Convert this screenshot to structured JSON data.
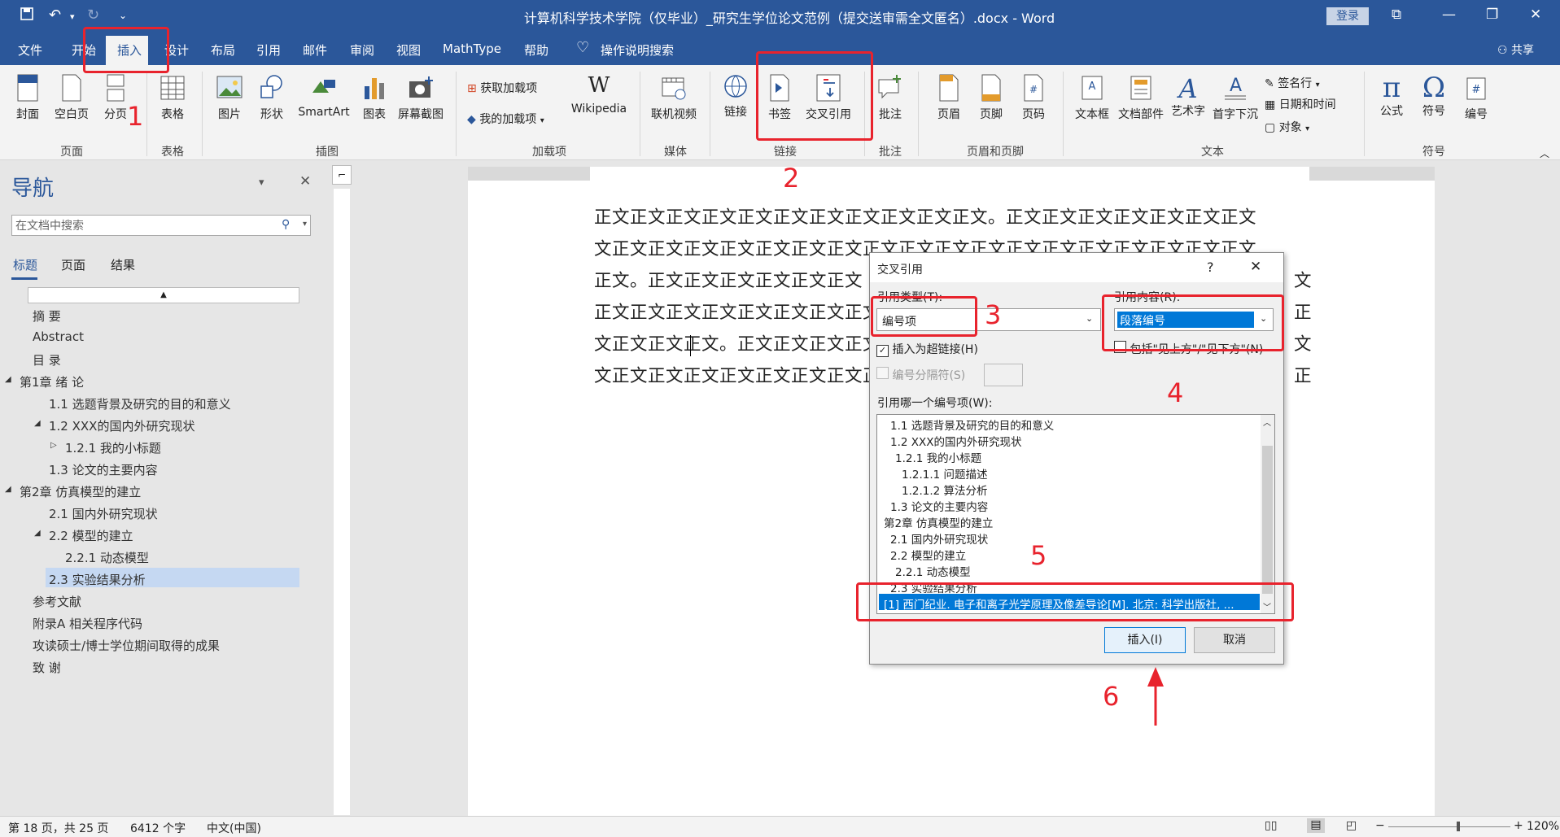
{
  "window": {
    "title": "计算机科学技术学院（仅毕业）_研究生学位论文范例（提交送审需全文匿名）.docx - Word",
    "login": "登录",
    "share": "共享"
  },
  "tabs": [
    "文件",
    "开始",
    "插入",
    "设计",
    "布局",
    "引用",
    "邮件",
    "审阅",
    "视图",
    "MathType",
    "帮助",
    "操作说明搜索"
  ],
  "ribbon": {
    "buttons": [
      "封面",
      "空白页",
      "分页",
      "表格",
      "图片",
      "形状",
      "SmartArt",
      "图表",
      "屏幕截图",
      "获取加载项",
      "我的加载项",
      "Wikipedia",
      "联机视频",
      "链接",
      "书签",
      "交叉引用",
      "批注",
      "页眉",
      "页脚",
      "页码",
      "文本框",
      "文档部件",
      "艺术字",
      "首字下沉",
      "签名行",
      "日期和时间",
      "对象",
      "公式",
      "符号",
      "编号"
    ],
    "groups": [
      "页面",
      "表格",
      "插图",
      "加载项",
      "媒体",
      "链接",
      "批注",
      "页眉和页脚",
      "文本",
      "符号"
    ]
  },
  "nav": {
    "title": "导航",
    "search_placeholder": "在文档中搜索",
    "tabs": [
      "标题",
      "页面",
      "结果"
    ],
    "items": [
      "摘 要",
      "Abstract",
      "目 录",
      "第1章 绪 论",
      "1.1 选题背景及研究的目的和意义",
      "1.2 XXX的国内外研究现状",
      "1.2.1 我的小标题",
      "1.3 论文的主要内容",
      "第2章 仿真模型的建立",
      "2.1 国内外研究现状",
      "2.2 模型的建立",
      "2.2.1 动态模型",
      "2.3 实验结果分析",
      "参考文献",
      "附录A 相关程序代码",
      "攻读硕士/博士学位期间取得的成果",
      "致 谢"
    ]
  },
  "document": {
    "lines": [
      "正文正文正文正文正文正文正文正文正文正文正文。正文正文正文正文正文正文正文",
      "文正文正文正文正文正文正文正文正文正文正文正文正文正文正文正文正文正文正文",
      "正文。正文正文正文正文正文正文",
      "正文正文正文正文正文正文正文正文",
      "文正文正文正文。正文正文正文正文正文",
      "文正文正文正文正文正文正文正文正文"
    ],
    "right_fragments": [
      "文",
      "正",
      "文",
      "正"
    ]
  },
  "dialog": {
    "title": "交叉引用",
    "help": "?",
    "ref_type_label": "引用类型(T):",
    "ref_type_value": "编号项",
    "ref_content_label": "引用内容(R):",
    "ref_content_value": "段落编号",
    "insert_hyperlink": "插入为超链接(H)",
    "include_above_below": "包括\"见上方\"/\"见下方\"(N)",
    "separator_label": "编号分隔符(S)",
    "which_label": "引用哪一个编号项(W):",
    "list": [
      "1.1 选题背景及研究的目的和意义",
      "1.2 XXX的国内外研究现状",
      "1.2.1 我的小标题",
      "1.2.1.1 问题描述",
      "1.2.1.2 算法分析",
      "1.3 论文的主要内容",
      "第2章 仿真模型的建立",
      "2.1 国内外研究现状",
      "2.2 模型的建立",
      "2.2.1 动态模型",
      "2.3 实验结果分析",
      "[1] 西门纪业. 电子和离子光学原理及像差导论[M]. 北京: 科学出版社, ..."
    ],
    "insert": "插入(I)",
    "cancel": "取消"
  },
  "annotations": [
    "1",
    "2",
    "3",
    "4",
    "5",
    "6"
  ],
  "status": {
    "page": "第 18 页，共 25 页",
    "words": "6412 个字",
    "lang": "中文(中国)",
    "zoom": "120%"
  },
  "colors": {
    "brand": "#2b579a",
    "annotation": "#e8232d",
    "selection": "#0078d7"
  }
}
